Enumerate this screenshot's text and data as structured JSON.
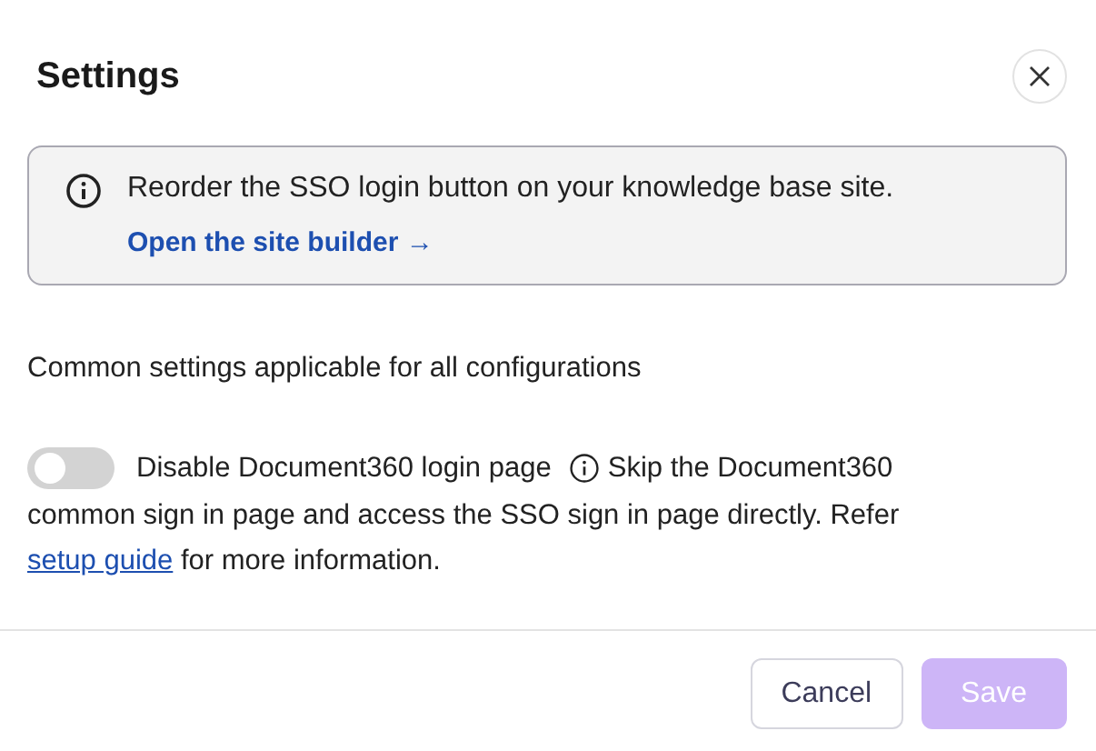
{
  "dialog": {
    "title": "Settings"
  },
  "notice": {
    "text": "Reorder the SSO login button on your knowledge base site.",
    "link": "Open the site builder →"
  },
  "section_heading": "Common settings applicable for all configurations",
  "toggle": {
    "label": "Disable Document360 login page",
    "on": false,
    "hint_first_line": "Skip the Document360",
    "hint_before": "common sign in page and access the SSO sign in page directly. Refer",
    "hint_link": "setup guide",
    "hint_after": "for more information."
  },
  "buttons": [
    {
      "label": "Cancel",
      "kind": "secondary",
      "disabled": false
    },
    {
      "label": "Save",
      "kind": "primary",
      "disabled": true
    }
  ]
}
